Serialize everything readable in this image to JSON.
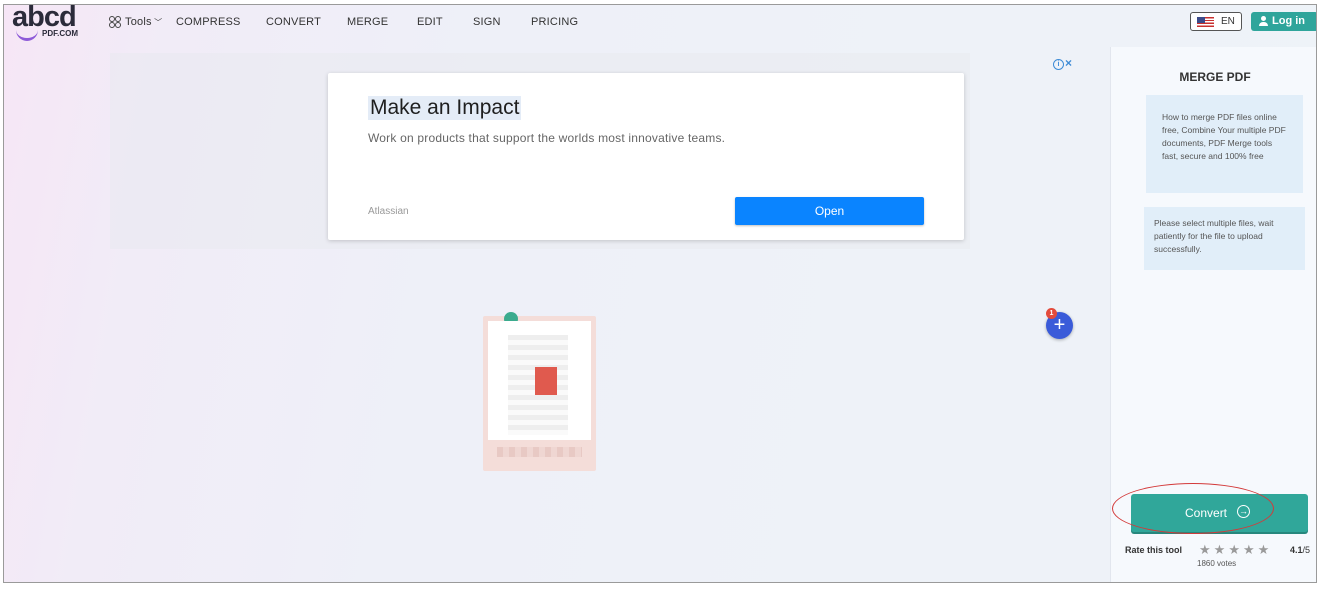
{
  "header": {
    "logo": {
      "main": "abcd",
      "sub": "PDF.COM"
    },
    "nav": {
      "tools": "Tools",
      "compress": "COMPRESS",
      "convert": "CONVERT",
      "merge": "MERGE",
      "edit": "EDIT",
      "sign": "SIGN",
      "pricing": "PRICING"
    },
    "language": "EN",
    "login": "Log in"
  },
  "ad": {
    "title": "Make an Impact",
    "description": "Work on products that support the worlds most innovative teams.",
    "advertiser": "Atlassian",
    "cta": "Open",
    "info_glyph": "i",
    "close_glyph": "×"
  },
  "uploader": {
    "add_glyph": "+",
    "file_count": "1"
  },
  "sidebar": {
    "title": "MERGE PDF",
    "info": "How to merge PDF files online free, Combine Your multiple PDF documents, PDF Merge tools fast, secure and 100% free",
    "hint": "Please select multiple files, wait patiently for the file to upload successfully.",
    "convert_label": "Convert",
    "rate_label": "Rate this tool",
    "rating_value": "4.1",
    "rating_max": "/5",
    "votes": "1860 votes"
  },
  "colors": {
    "accent": "#30a79a",
    "ad_button": "#0a84ff",
    "add_button": "#3a5bd9",
    "annotation_ring": "#d33a3a"
  }
}
